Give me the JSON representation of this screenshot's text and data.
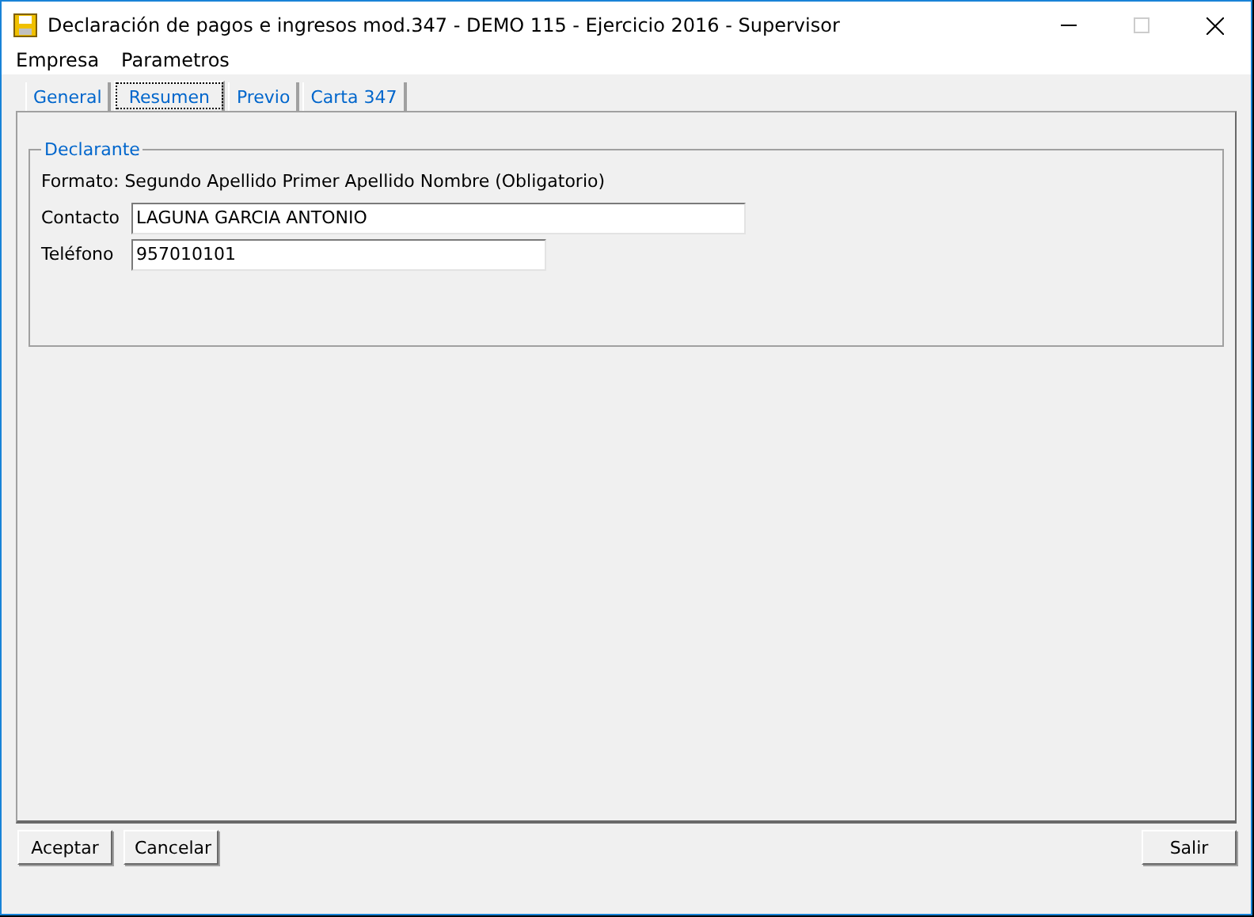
{
  "window": {
    "title": "Declaración de pagos e ingresos mod.347 - DEMO 115 - Ejercicio 2016 - Supervisor"
  },
  "menu": [
    "Empresa",
    "Parametros"
  ],
  "tabs": [
    {
      "label": "General",
      "selected": false
    },
    {
      "label": "Resumen",
      "selected": true
    },
    {
      "label": "Previo",
      "selected": false
    },
    {
      "label": "Carta 347",
      "selected": false
    }
  ],
  "group": {
    "title": "Declarante",
    "hint": "Formato: Segundo Apellido Primer Apellido Nombre (Obligatorio)",
    "fields": [
      {
        "label": "Contacto",
        "value": "LAGUNA GARCIA ANTONIO",
        "wide": true
      },
      {
        "label": "Teléfono",
        "value": "957010101",
        "wide": false
      }
    ]
  },
  "buttons_left": [
    "Aceptar",
    "Cancelar"
  ],
  "buttons_right": [
    "Salir"
  ]
}
